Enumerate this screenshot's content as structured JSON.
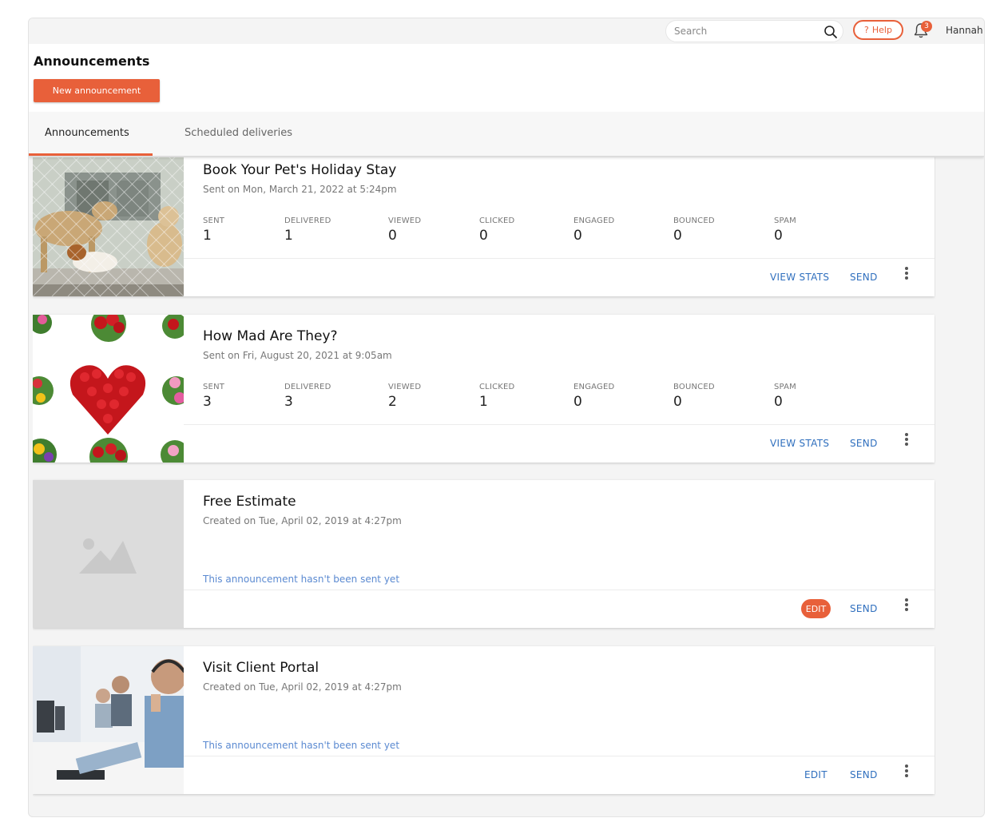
{
  "topbar": {
    "search_placeholder": "Search",
    "help_label": "Help",
    "help_glyph": "?",
    "notification_count": "3",
    "user_name": "Hannah"
  },
  "header": {
    "title": "Announcements",
    "new_button": "New announcement"
  },
  "tabs": [
    {
      "label": "Announcements",
      "active": true
    },
    {
      "label": "Scheduled deliveries",
      "active": false
    }
  ],
  "colors": {
    "accent": "#e8603a",
    "link": "#2f6fbe",
    "not_sent_text": "#5b8ad1"
  },
  "stat_labels": [
    "SENT",
    "DELIVERED",
    "VIEWED",
    "CLICKED",
    "ENGAGED",
    "BOUNCED",
    "SPAM"
  ],
  "announcements": [
    {
      "title": "Book Your Pet's Holiday Stay",
      "subtitle": "Sent on Mon, March 21, 2022 at 5:24pm",
      "image": "dogs-photo",
      "stats": [
        "1",
        "1",
        "0",
        "0",
        "0",
        "0",
        "0"
      ],
      "actions": [
        "VIEW STATS",
        "SEND"
      ]
    },
    {
      "title": "How Mad Are They?",
      "subtitle": "Sent on Fri, August 20, 2021 at 9:05am",
      "image": "flowers-heart-photo",
      "stats": [
        "3",
        "3",
        "2",
        "1",
        "0",
        "0",
        "0"
      ],
      "actions": [
        "VIEW STATS",
        "SEND"
      ]
    },
    {
      "title": "Free Estimate",
      "subtitle": "Created on Tue, April 02, 2019 at 4:27pm",
      "image": "image-placeholder-icon",
      "not_sent": "This announcement hasn't been sent yet",
      "actions": [
        "EDIT",
        "SEND"
      ]
    },
    {
      "title": "Visit Client Portal",
      "subtitle": "Created on Tue, April 02, 2019 at 4:27pm",
      "image": "call-center-photo",
      "not_sent": "This announcement hasn't been sent yet",
      "actions": [
        "EDIT",
        "SEND"
      ]
    }
  ]
}
